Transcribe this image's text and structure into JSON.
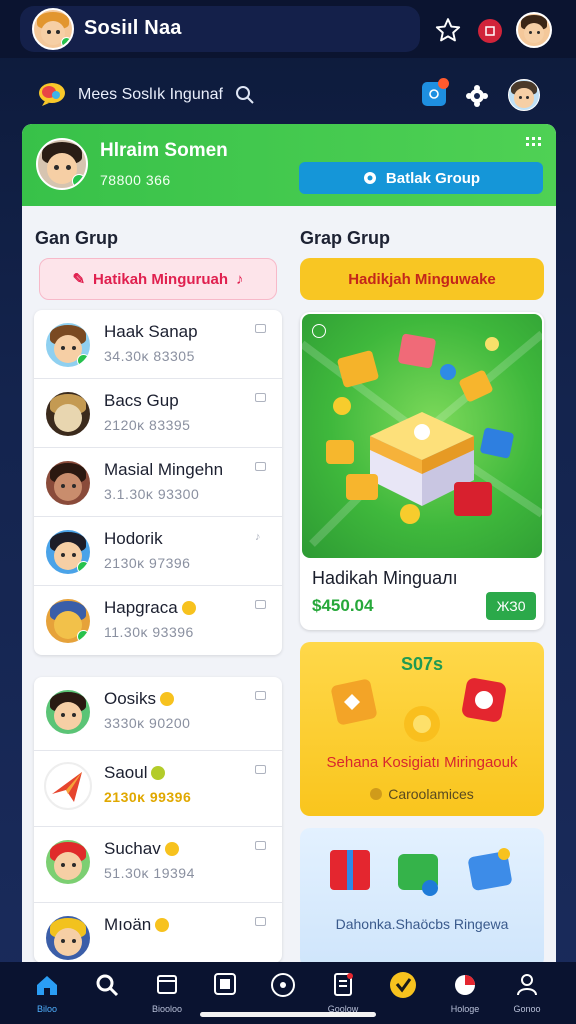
{
  "topbar": {
    "title": "Sosiıl Naa",
    "icons": [
      "star-icon",
      "notification-icon",
      "profile-avatar"
    ]
  },
  "searchrow": {
    "text": "Mees Soslık Ingunaf",
    "icons": [
      "chat-bubble-icon",
      "search-icon",
      "inbox-icon",
      "settings-icon",
      "user-avatar"
    ]
  },
  "profile": {
    "name": "Hlraim Somen",
    "stats": "78800 366",
    "join_button": "Batlak Group"
  },
  "left": {
    "heading": "Gan Grup",
    "weekly_label": "Hatikah Minguruah",
    "members": [
      {
        "name": "Haak Sanap",
        "stat": "34.30ĸ 83305",
        "crown": false
      },
      {
        "name": "Bacs Gup",
        "stat": "2120ĸ 83395",
        "crown": false
      },
      {
        "name": "Masial Mingehn",
        "stat": "3.1.30ĸ 93300",
        "crown": false
      },
      {
        "name": "Hodorik",
        "stat": "2130ĸ 97396",
        "crown": false
      },
      {
        "name": "Hapgraca",
        "stat": "11.30ĸ 93396",
        "crown": true
      }
    ],
    "members2": [
      {
        "name": "Oosiks",
        "stat": "3330ĸ 90200",
        "crown": true
      },
      {
        "name": "Saoul",
        "stat": "2130ĸ 99396",
        "crown": true
      },
      {
        "name": "Suchav",
        "stat": "51.30ĸ 19394",
        "crown": true
      },
      {
        "name": "Mıoän",
        "stat": "",
        "crown": true
      }
    ]
  },
  "right": {
    "heading": "Grap Grup",
    "weekly_label": "Hadikjah Minguwake",
    "reward": {
      "title": "Hadikah Minguaлı",
      "price": "$450.04",
      "button": "ЖЗ0"
    },
    "yellow_card": {
      "top": "S07s",
      "title": "Sehana Kosigiatı Miringaouk",
      "foot": "Caroolamices"
    },
    "blue_card": {
      "title": "Dahonka.Shaöcbs Ringewa"
    }
  },
  "nav": [
    {
      "label": "Biloo",
      "icon": "home-icon"
    },
    {
      "label": "",
      "icon": "search-people-icon"
    },
    {
      "label": "Biooloo",
      "icon": "calendar-icon"
    },
    {
      "label": "",
      "icon": "square-icon"
    },
    {
      "label": "",
      "icon": "disc-icon"
    },
    {
      "label": "Goolow",
      "icon": "document-icon"
    },
    {
      "label": "",
      "icon": "check-badge-icon"
    },
    {
      "label": "Hologe",
      "icon": "pie-icon"
    },
    {
      "label": "Gonoo",
      "icon": "group-icon"
    }
  ],
  "colors": {
    "header_green": "#38c149",
    "join_blue": "#1596d8",
    "weekly_pink": "#fde4ea",
    "weekly_gold": "#f8c623",
    "price_green": "#26a83a"
  }
}
